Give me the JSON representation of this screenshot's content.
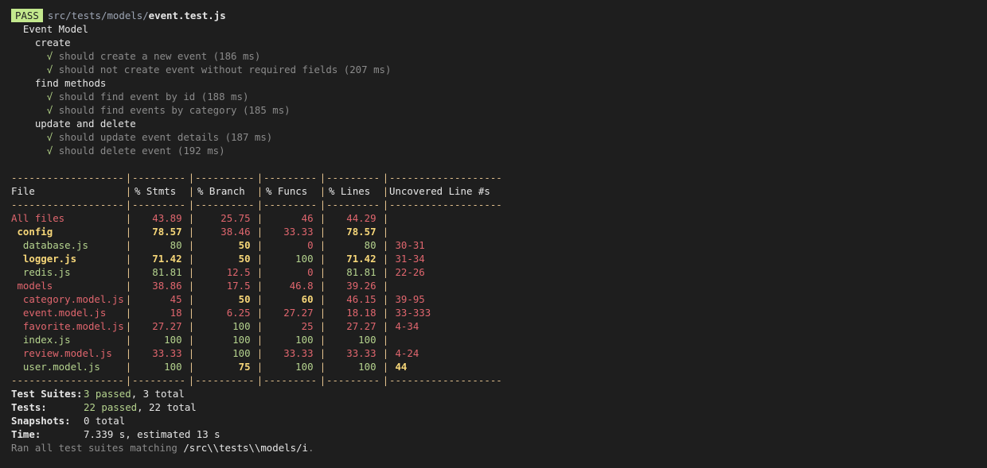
{
  "header": {
    "badge": "PASS",
    "path_dir": "src/tests/models/",
    "path_file": "event.test.js"
  },
  "suite": {
    "title": "Event Model",
    "groups": [
      {
        "name": "create",
        "tests": [
          {
            "check": "√",
            "text": "should create a new event (186 ms)"
          },
          {
            "check": "√",
            "text": "should not create event without required fields (207 ms)"
          }
        ]
      },
      {
        "name": "find methods",
        "tests": [
          {
            "check": "√",
            "text": "should find event by id (188 ms)"
          },
          {
            "check": "√",
            "text": "should find events by category (185 ms)"
          }
        ]
      },
      {
        "name": "update and delete",
        "tests": [
          {
            "check": "√",
            "text": "should update event details (187 ms)"
          },
          {
            "check": "√",
            "text": "should delete event (192 ms)"
          }
        ]
      }
    ]
  },
  "coverage": {
    "dash_row": "--------------------|---------|----------|---------|---------|-------------------",
    "headers": [
      "File",
      "% Stmts",
      "% Branch",
      "% Funcs",
      "% Lines",
      "Uncovered Line #s"
    ],
    "rows": [
      {
        "file": "All files",
        "indent": 0,
        "bold": false,
        "file_color": "red",
        "stmts": "43.89",
        "stmts_c": "red",
        "branch": "25.75",
        "branch_c": "red",
        "funcs": "46",
        "funcs_c": "red",
        "lines": "44.29",
        "lines_c": "red",
        "unc": "",
        "unc_c": "red"
      },
      {
        "file": "config",
        "indent": 1,
        "bold": true,
        "file_color": "yellow",
        "stmts": "78.57",
        "stmts_c": "yellow",
        "branch": "38.46",
        "branch_c": "red",
        "funcs": "33.33",
        "funcs_c": "red",
        "lines": "78.57",
        "lines_c": "yellow",
        "unc": "",
        "unc_c": "red"
      },
      {
        "file": "database.js",
        "indent": 2,
        "bold": false,
        "file_color": "green",
        "stmts": "80",
        "stmts_c": "green",
        "branch": "50",
        "branch_c": "yellow",
        "funcs": "0",
        "funcs_c": "red",
        "lines": "80",
        "lines_c": "green",
        "unc": "30-31",
        "unc_c": "red"
      },
      {
        "file": "logger.js",
        "indent": 2,
        "bold": true,
        "file_color": "yellow",
        "stmts": "71.42",
        "stmts_c": "yellow",
        "branch": "50",
        "branch_c": "yellow",
        "funcs": "100",
        "funcs_c": "green",
        "lines": "71.42",
        "lines_c": "yellow",
        "unc": "31-34",
        "unc_c": "red"
      },
      {
        "file": "redis.js",
        "indent": 2,
        "bold": false,
        "file_color": "green",
        "stmts": "81.81",
        "stmts_c": "green",
        "branch": "12.5",
        "branch_c": "red",
        "funcs": "0",
        "funcs_c": "red",
        "lines": "81.81",
        "lines_c": "green",
        "unc": "22-26",
        "unc_c": "red"
      },
      {
        "file": "models",
        "indent": 1,
        "bold": false,
        "file_color": "red",
        "stmts": "38.86",
        "stmts_c": "red",
        "branch": "17.5",
        "branch_c": "red",
        "funcs": "46.8",
        "funcs_c": "red",
        "lines": "39.26",
        "lines_c": "red",
        "unc": "",
        "unc_c": "red"
      },
      {
        "file": "category.model.js",
        "indent": 2,
        "bold": false,
        "file_color": "red",
        "stmts": "45",
        "stmts_c": "red",
        "branch": "50",
        "branch_c": "yellow",
        "funcs": "60",
        "funcs_c": "yellow",
        "lines": "46.15",
        "lines_c": "red",
        "unc": "39-95",
        "unc_c": "red"
      },
      {
        "file": "event.model.js",
        "indent": 2,
        "bold": false,
        "file_color": "red",
        "stmts": "18",
        "stmts_c": "red",
        "branch": "6.25",
        "branch_c": "red",
        "funcs": "27.27",
        "funcs_c": "red",
        "lines": "18.18",
        "lines_c": "red",
        "unc": "33-333",
        "unc_c": "red"
      },
      {
        "file": "favorite.model.js",
        "indent": 2,
        "bold": false,
        "file_color": "red",
        "stmts": "27.27",
        "stmts_c": "red",
        "branch": "100",
        "branch_c": "green",
        "funcs": "25",
        "funcs_c": "red",
        "lines": "27.27",
        "lines_c": "red",
        "unc": "4-34",
        "unc_c": "red"
      },
      {
        "file": "index.js",
        "indent": 2,
        "bold": false,
        "file_color": "green",
        "stmts": "100",
        "stmts_c": "green",
        "branch": "100",
        "branch_c": "green",
        "funcs": "100",
        "funcs_c": "green",
        "lines": "100",
        "lines_c": "green",
        "unc": "",
        "unc_c": "red"
      },
      {
        "file": "review.model.js",
        "indent": 2,
        "bold": false,
        "file_color": "red",
        "stmts": "33.33",
        "stmts_c": "red",
        "branch": "100",
        "branch_c": "green",
        "funcs": "33.33",
        "funcs_c": "red",
        "lines": "33.33",
        "lines_c": "red",
        "unc": "4-24",
        "unc_c": "red"
      },
      {
        "file": "user.model.js",
        "indent": 2,
        "bold": false,
        "file_color": "green",
        "stmts": "100",
        "stmts_c": "green",
        "branch": "75",
        "branch_c": "yellow",
        "funcs": "100",
        "funcs_c": "green",
        "lines": "100",
        "lines_c": "green",
        "unc": "44",
        "unc_c": "yellow"
      }
    ]
  },
  "summary": [
    {
      "key": "Test Suites:",
      "passed": "3 passed",
      "rest": ", 3 total"
    },
    {
      "key": "Tests:",
      "passed": "22 passed",
      "rest": ", 22 total"
    },
    {
      "key": "Snapshots:",
      "passed": "",
      "rest": "0 total"
    },
    {
      "key": "Time:",
      "passed": "",
      "rest": "7.339 s, estimated 13 s"
    }
  ],
  "footer": {
    "prefix": "Ran all test suites matching ",
    "pattern": "/src\\\\tests\\\\models/i",
    "suffix": "."
  },
  "colors": {
    "background": "#1e1e1e",
    "pass_badge": "#c3e88d",
    "red": "#e0666e",
    "yellow": "#f7d779",
    "green": "#b5d38e"
  }
}
